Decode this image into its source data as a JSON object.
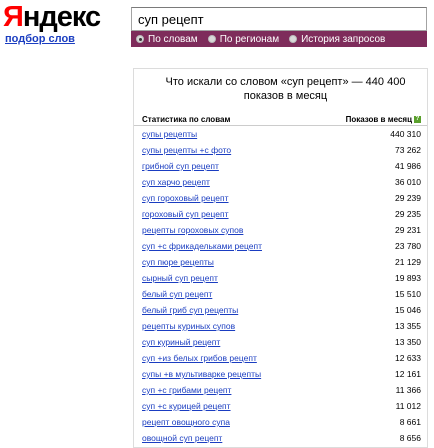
{
  "logo": {
    "first_letter": "Я",
    "rest": "ндекс"
  },
  "subtitle": "подбор слов",
  "search": {
    "value": "суп рецепт"
  },
  "tabs": [
    {
      "label": "По словам",
      "checked": true
    },
    {
      "label": "По регионам",
      "checked": false
    },
    {
      "label": "История запросов",
      "checked": false
    }
  ],
  "panel": {
    "title": "Что искали со словом «суп рецепт» — 440 400 показов в месяц",
    "col_left": "Статистика по словам",
    "col_right": "Показов в месяц",
    "help_icon": "?"
  },
  "rows": [
    {
      "query": "супы рецепты",
      "count": "440 310"
    },
    {
      "query": "супы рецепты +с фото",
      "count": "73 262"
    },
    {
      "query": "грибной суп рецепт",
      "count": "41 986"
    },
    {
      "query": "суп харчо рецепт",
      "count": "36 010"
    },
    {
      "query": "суп гороховый рецепт",
      "count": "29 239"
    },
    {
      "query": "гороховый суп рецепт",
      "count": "29 235"
    },
    {
      "query": "рецепты гороховых супов",
      "count": "29 231"
    },
    {
      "query": "суп +с фрикадельками рецепт",
      "count": "23 780"
    },
    {
      "query": "суп пюре рецепты",
      "count": "21 129"
    },
    {
      "query": "сырный суп рецепт",
      "count": "19 893"
    },
    {
      "query": "белый суп рецепт",
      "count": "15 510"
    },
    {
      "query": "белый гриб суп рецепты",
      "count": "15 046"
    },
    {
      "query": "рецепты куриных супов",
      "count": "13 355"
    },
    {
      "query": "суп куриный рецепт",
      "count": "13 350"
    },
    {
      "query": "суп +из белых грибов рецепт",
      "count": "12 633"
    },
    {
      "query": "супы +в мультиварке рецепты",
      "count": "12 161"
    },
    {
      "query": "суп +с грибами рецепт",
      "count": "11 366"
    },
    {
      "query": "суп +с курицей рецепт",
      "count": "11 012"
    },
    {
      "query": "рецепт овощного супа",
      "count": "8 661"
    },
    {
      "query": "овощной суп рецепт",
      "count": "8 656"
    }
  ]
}
